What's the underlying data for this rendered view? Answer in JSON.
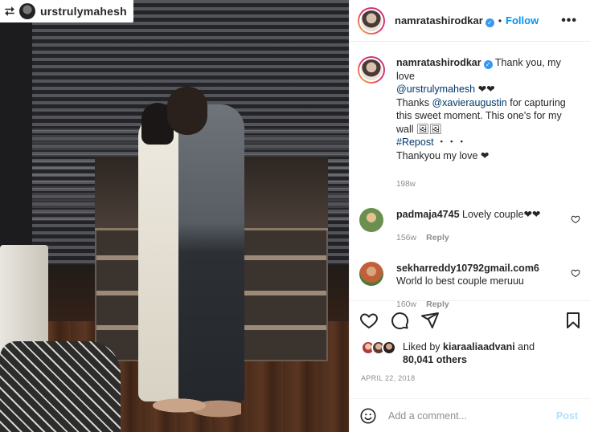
{
  "repost": {
    "icon": "repost-icon",
    "username": "urstrulymahesh"
  },
  "header": {
    "username": "namratashirodkar",
    "verified": true,
    "separator": "•",
    "follow_label": "Follow",
    "more_label": "•••"
  },
  "caption": {
    "username": "namratashirodkar",
    "line1": " Thank you, my love",
    "mention1": "@urstrulymahesh",
    "hearts1": " ❤❤",
    "thanks": "Thanks ",
    "mention2": "@xavieraugustin",
    "rest": " for capturing this sweet moment. This one's for my wall 🖼🖼",
    "hashtag": "#Repost",
    "dots": " ・・・",
    "final": "Thankyou my love ❤",
    "time": "198w"
  },
  "comments": [
    {
      "username": "padmaja4745",
      "text": " Lovely couple❤❤",
      "time": "156w",
      "reply_label": "Reply",
      "avatar_color": "#6b8f4e"
    },
    {
      "username": "sekharreddy10792gmail.com6",
      "text": "World lo best couple meruuu",
      "time": "160w",
      "reply_label": "Reply",
      "avatar_color": "#c0603a"
    }
  ],
  "likes": {
    "prefix": "Liked by ",
    "user": "kiaraaliaadvani",
    "and": " and",
    "count": "80,041 others"
  },
  "date": "APRIL 22, 2018",
  "comment_box": {
    "placeholder": "Add a comment...",
    "post_label": "Post"
  },
  "colors": {
    "accent": "#0095f6",
    "text": "#262626",
    "muted": "#8e8e8e"
  }
}
